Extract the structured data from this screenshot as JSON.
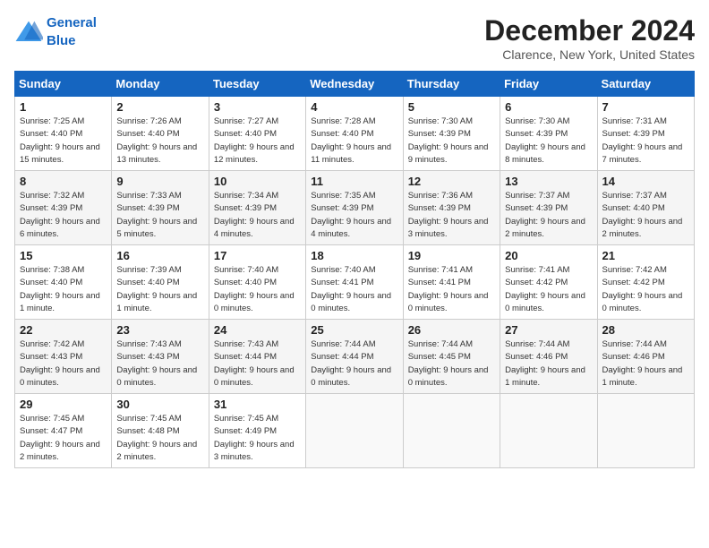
{
  "logo": {
    "line1": "General",
    "line2": "Blue"
  },
  "title": "December 2024",
  "location": "Clarence, New York, United States",
  "weekdays": [
    "Sunday",
    "Monday",
    "Tuesday",
    "Wednesday",
    "Thursday",
    "Friday",
    "Saturday"
  ],
  "weeks": [
    [
      {
        "day": "1",
        "sunrise": "7:25 AM",
        "sunset": "4:40 PM",
        "daylight": "9 hours and 15 minutes."
      },
      {
        "day": "2",
        "sunrise": "7:26 AM",
        "sunset": "4:40 PM",
        "daylight": "9 hours and 13 minutes."
      },
      {
        "day": "3",
        "sunrise": "7:27 AM",
        "sunset": "4:40 PM",
        "daylight": "9 hours and 12 minutes."
      },
      {
        "day": "4",
        "sunrise": "7:28 AM",
        "sunset": "4:40 PM",
        "daylight": "9 hours and 11 minutes."
      },
      {
        "day": "5",
        "sunrise": "7:30 AM",
        "sunset": "4:39 PM",
        "daylight": "9 hours and 9 minutes."
      },
      {
        "day": "6",
        "sunrise": "7:30 AM",
        "sunset": "4:39 PM",
        "daylight": "9 hours and 8 minutes."
      },
      {
        "day": "7",
        "sunrise": "7:31 AM",
        "sunset": "4:39 PM",
        "daylight": "9 hours and 7 minutes."
      }
    ],
    [
      {
        "day": "8",
        "sunrise": "7:32 AM",
        "sunset": "4:39 PM",
        "daylight": "9 hours and 6 minutes."
      },
      {
        "day": "9",
        "sunrise": "7:33 AM",
        "sunset": "4:39 PM",
        "daylight": "9 hours and 5 minutes."
      },
      {
        "day": "10",
        "sunrise": "7:34 AM",
        "sunset": "4:39 PM",
        "daylight": "9 hours and 4 minutes."
      },
      {
        "day": "11",
        "sunrise": "7:35 AM",
        "sunset": "4:39 PM",
        "daylight": "9 hours and 4 minutes."
      },
      {
        "day": "12",
        "sunrise": "7:36 AM",
        "sunset": "4:39 PM",
        "daylight": "9 hours and 3 minutes."
      },
      {
        "day": "13",
        "sunrise": "7:37 AM",
        "sunset": "4:39 PM",
        "daylight": "9 hours and 2 minutes."
      },
      {
        "day": "14",
        "sunrise": "7:37 AM",
        "sunset": "4:40 PM",
        "daylight": "9 hours and 2 minutes."
      }
    ],
    [
      {
        "day": "15",
        "sunrise": "7:38 AM",
        "sunset": "4:40 PM",
        "daylight": "9 hours and 1 minute."
      },
      {
        "day": "16",
        "sunrise": "7:39 AM",
        "sunset": "4:40 PM",
        "daylight": "9 hours and 1 minute."
      },
      {
        "day": "17",
        "sunrise": "7:40 AM",
        "sunset": "4:40 PM",
        "daylight": "9 hours and 0 minutes."
      },
      {
        "day": "18",
        "sunrise": "7:40 AM",
        "sunset": "4:41 PM",
        "daylight": "9 hours and 0 minutes."
      },
      {
        "day": "19",
        "sunrise": "7:41 AM",
        "sunset": "4:41 PM",
        "daylight": "9 hours and 0 minutes."
      },
      {
        "day": "20",
        "sunrise": "7:41 AM",
        "sunset": "4:42 PM",
        "daylight": "9 hours and 0 minutes."
      },
      {
        "day": "21",
        "sunrise": "7:42 AM",
        "sunset": "4:42 PM",
        "daylight": "9 hours and 0 minutes."
      }
    ],
    [
      {
        "day": "22",
        "sunrise": "7:42 AM",
        "sunset": "4:43 PM",
        "daylight": "9 hours and 0 minutes."
      },
      {
        "day": "23",
        "sunrise": "7:43 AM",
        "sunset": "4:43 PM",
        "daylight": "9 hours and 0 minutes."
      },
      {
        "day": "24",
        "sunrise": "7:43 AM",
        "sunset": "4:44 PM",
        "daylight": "9 hours and 0 minutes."
      },
      {
        "day": "25",
        "sunrise": "7:44 AM",
        "sunset": "4:44 PM",
        "daylight": "9 hours and 0 minutes."
      },
      {
        "day": "26",
        "sunrise": "7:44 AM",
        "sunset": "4:45 PM",
        "daylight": "9 hours and 0 minutes."
      },
      {
        "day": "27",
        "sunrise": "7:44 AM",
        "sunset": "4:46 PM",
        "daylight": "9 hours and 1 minute."
      },
      {
        "day": "28",
        "sunrise": "7:44 AM",
        "sunset": "4:46 PM",
        "daylight": "9 hours and 1 minute."
      }
    ],
    [
      {
        "day": "29",
        "sunrise": "7:45 AM",
        "sunset": "4:47 PM",
        "daylight": "9 hours and 2 minutes."
      },
      {
        "day": "30",
        "sunrise": "7:45 AM",
        "sunset": "4:48 PM",
        "daylight": "9 hours and 2 minutes."
      },
      {
        "day": "31",
        "sunrise": "7:45 AM",
        "sunset": "4:49 PM",
        "daylight": "9 hours and 3 minutes."
      },
      null,
      null,
      null,
      null
    ]
  ]
}
